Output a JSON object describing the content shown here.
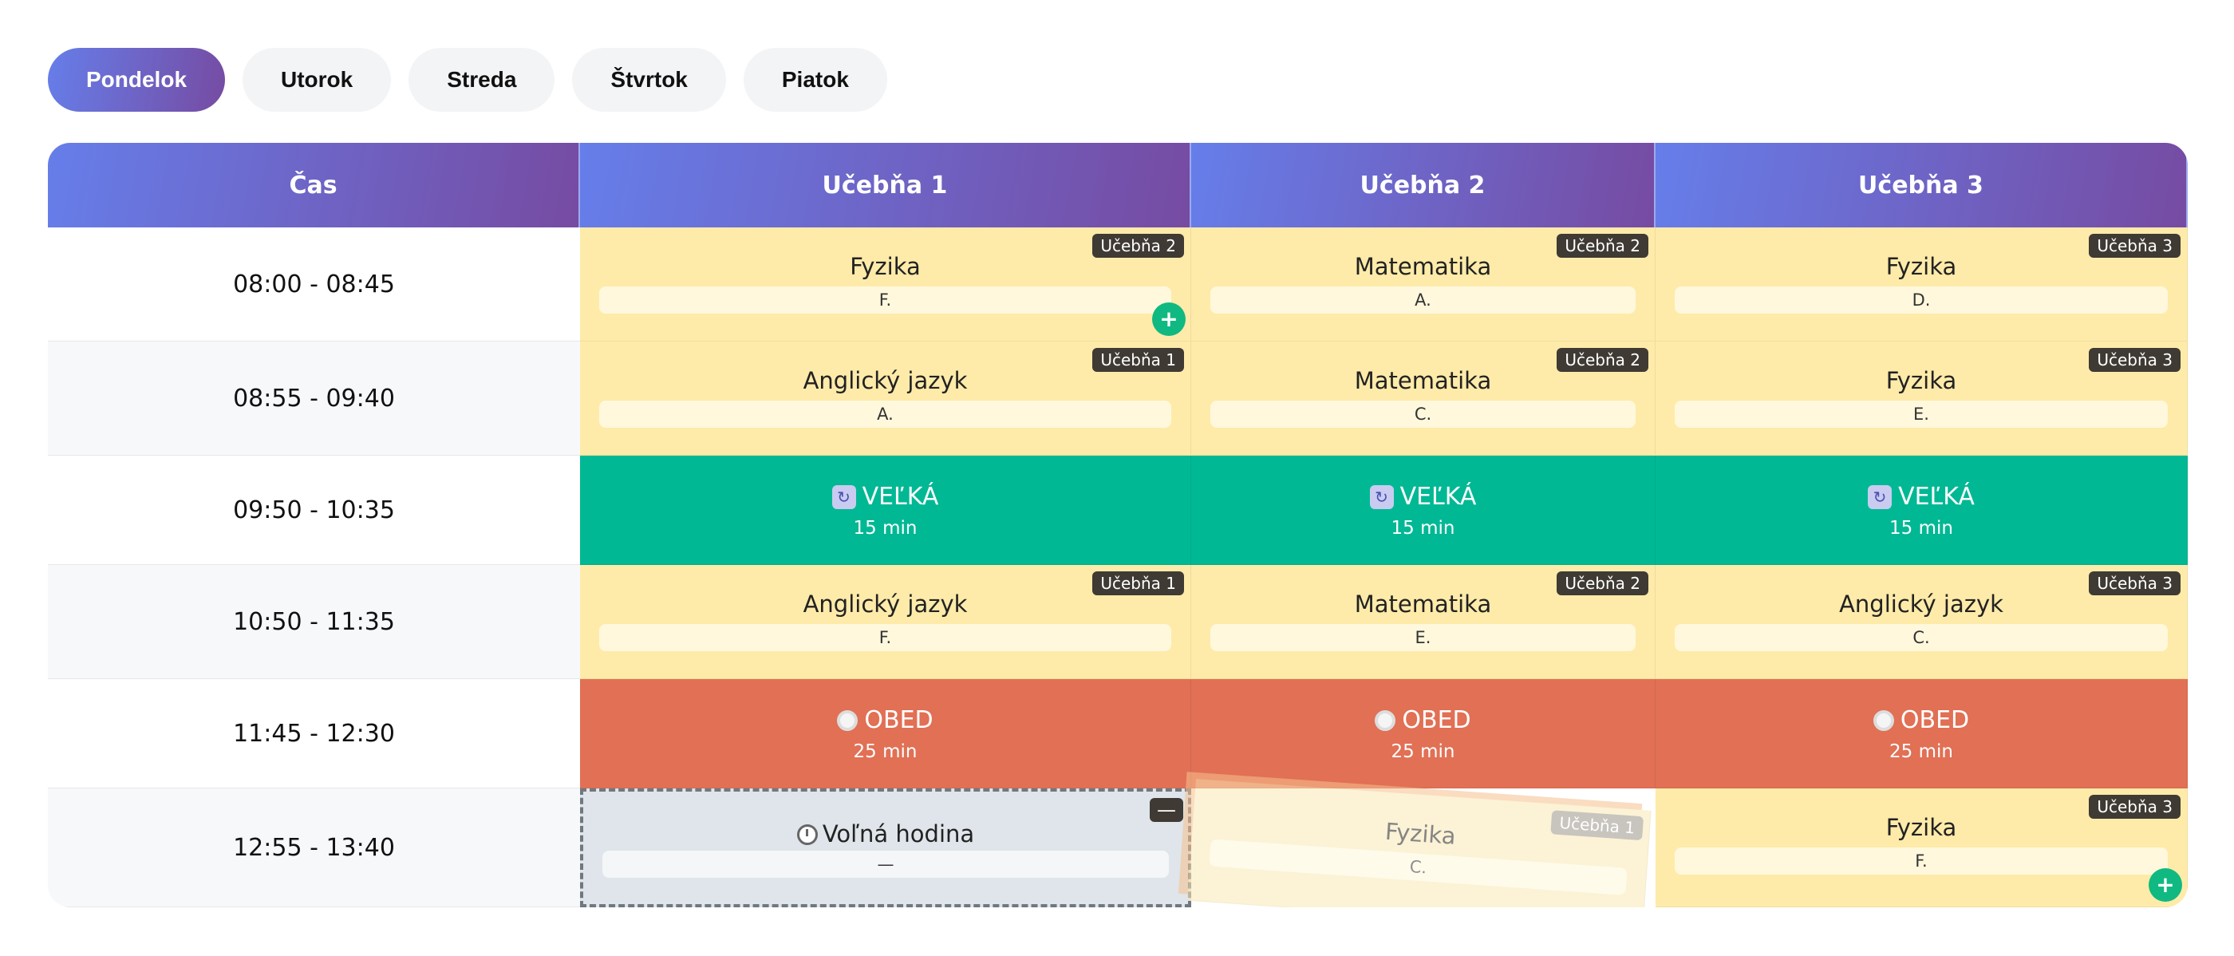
{
  "days": [
    {
      "label": "Pondelok",
      "active": true
    },
    {
      "label": "Utorok",
      "active": false
    },
    {
      "label": "Streda",
      "active": false
    },
    {
      "label": "Štvrtok",
      "active": false
    },
    {
      "label": "Piatok",
      "active": false
    }
  ],
  "table": {
    "headers": [
      "Čas",
      "Učebňa 1",
      "Učebňa 2",
      "Učebňa 3"
    ],
    "rows": [
      {
        "time": "08:00 - 08:45",
        "cells": [
          {
            "type": "lesson",
            "subject": "Fyzika",
            "teacher": "F.",
            "room": "Učebňa 2",
            "add": "+"
          },
          {
            "type": "lesson",
            "subject": "Matematika",
            "teacher": "A.",
            "room": "Učebňa 2"
          },
          {
            "type": "lesson",
            "subject": "Fyzika",
            "teacher": "D.",
            "room": "Učebňa 3"
          }
        ]
      },
      {
        "time": "08:55 - 09:40",
        "cells": [
          {
            "type": "lesson",
            "subject": "Anglický jazyk",
            "teacher": "A.",
            "room": "Učebňa 1"
          },
          {
            "type": "lesson",
            "subject": "Matematika",
            "teacher": "C.",
            "room": "Učebňa 2"
          },
          {
            "type": "lesson",
            "subject": "Fyzika",
            "teacher": "E.",
            "room": "Učebňa 3"
          }
        ]
      },
      {
        "time": "09:50 - 10:35",
        "cells": [
          {
            "type": "break",
            "title": "VEĽKÁ",
            "duration": "15 min"
          },
          {
            "type": "break",
            "title": "VEĽKÁ",
            "duration": "15 min"
          },
          {
            "type": "break",
            "title": "VEĽKÁ",
            "duration": "15 min"
          }
        ]
      },
      {
        "time": "10:50 - 11:35",
        "cells": [
          {
            "type": "lesson",
            "subject": "Anglický jazyk",
            "teacher": "F.",
            "room": "Učebňa 1"
          },
          {
            "type": "lesson",
            "subject": "Matematika",
            "teacher": "E.",
            "room": "Učebňa 2"
          },
          {
            "type": "lesson",
            "subject": "Anglický jazyk",
            "teacher": "C.",
            "room": "Učebňa 3"
          }
        ]
      },
      {
        "time": "11:45 - 12:30",
        "cells": [
          {
            "type": "lunch",
            "title": "OBED",
            "duration": "25 min"
          },
          {
            "type": "lunch",
            "title": "OBED",
            "duration": "25 min"
          },
          {
            "type": "lunch",
            "title": "OBED",
            "duration": "25 min"
          }
        ]
      },
      {
        "time": "12:55 - 13:40",
        "cells": [
          {
            "type": "free",
            "subject": "Voľná hodina",
            "teacher": "—",
            "remove": "—"
          },
          {
            "type": "dragging",
            "subject": "Fyzika",
            "teacher": "C.",
            "room": "Učebňa 1"
          },
          {
            "type": "lesson",
            "subject": "Fyzika",
            "teacher": "F.",
            "room": "Učebňa 3",
            "add": "+"
          }
        ]
      }
    ]
  },
  "colors": {
    "accent_gradient_start": "#667eea",
    "accent_gradient_end": "#764ba2",
    "lesson": "#feeba9",
    "break": "#00b894",
    "lunch": "#e17055",
    "free": "#dfe5ea",
    "add_button": "#10b981"
  },
  "icons": {
    "break": "swap-icon",
    "lunch": "plate-icon",
    "free": "clock-icon"
  }
}
